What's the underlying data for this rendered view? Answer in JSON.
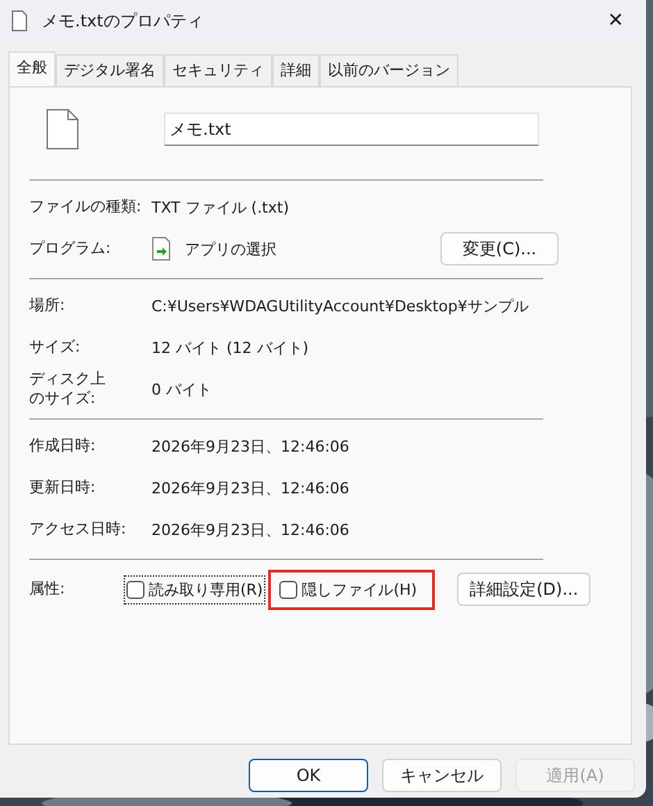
{
  "window": {
    "title": "メモ.txtのプロパティ",
    "close": "✕"
  },
  "tabs": [
    {
      "label": "全般",
      "selected": true
    },
    {
      "label": "デジタル署名",
      "selected": false
    },
    {
      "label": "セキュリティ",
      "selected": false
    },
    {
      "label": "詳細",
      "selected": false
    },
    {
      "label": "以前のバージョン",
      "selected": false
    }
  ],
  "file_name": {
    "value": "メモ.txt"
  },
  "sections": [
    [
      {
        "label": "ファイルの種類:",
        "value": "TXT ファイル (.txt)"
      },
      {
        "label": "プログラム:",
        "value": "アプリの選択",
        "kind": "program",
        "button": "変更(C)..."
      }
    ],
    [
      {
        "label": "場所:",
        "value": "C:¥Users¥WDAGUtilityAccount¥Desktop¥サンプル"
      },
      {
        "label": "サイズ:",
        "value": "12 バイト (12 バイト)"
      },
      {
        "label": "ディスク上のサイズ:",
        "value": "0 バイト",
        "kind": "narrow"
      }
    ],
    [
      {
        "label": "作成日時:",
        "value": "2026年9月23日、12:46:06"
      },
      {
        "label": "更新日時:",
        "value": "2026年9月23日、12:46:06"
      },
      {
        "label": "アクセス日時:",
        "value": "2026年9月23日、12:46:06"
      }
    ]
  ],
  "attributes": {
    "label": "属性:",
    "items": [
      {
        "label": "読み取り専用(R)",
        "checked": false,
        "focused": true,
        "highlighted": false
      },
      {
        "label": "隠しファイル(H)",
        "checked": false,
        "focused": false,
        "highlighted": true
      }
    ],
    "button": "詳細設定(D)..."
  },
  "buttons": [
    {
      "label": "OK",
      "kind": "default",
      "disabled": false
    },
    {
      "label": "キャンセル",
      "kind": "normal",
      "disabled": false
    },
    {
      "label": "適用(A)",
      "kind": "normal",
      "disabled": true
    }
  ]
}
